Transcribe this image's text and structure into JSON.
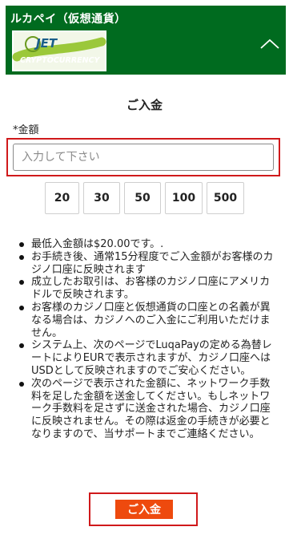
{
  "header": {
    "title": "ルカペイ（仮想通貨）",
    "logo_top_text": "JET",
    "logo_bottom_text": "CRYPTOCURRENCY",
    "collapse_icon": "chevron-up-icon",
    "bg_color": "#006b1f"
  },
  "form": {
    "title": "ご入金",
    "amount_label": "*金額",
    "amount_placeholder": "入力して下さい",
    "amount_value": "",
    "quick_amounts": [
      "20",
      "30",
      "50",
      "100",
      "500"
    ]
  },
  "notes": [
    "最低入金額は$20.00です。.",
    "お手続き後、通常15分程度でご入金額がお客様のカジノ口座に反映されます",
    "成立したお取引は、お客様のカジノ口座にアメリカドルで反映されます。",
    "お客様のカジノ口座と仮想通貨の口座との名義が異なる場合は、カジノへのご入金にご利用いただけません。",
    "システム上、次のページでLuqaPayの定める為替レートによりEURで表示されますが、カジノ口座へはUSDとして反映されますのでご安心ください。",
    "次のページで表示された金額に、ネットワーク手数料を足した金額を送金してください。もしネットワーク手数料を足さずに送金された場合、カジノ口座に反映されません。その際は返金の手続きが必要となりますので、当サポートまでご連絡ください。"
  ],
  "submit": {
    "label": "ご入金",
    "color": "#ee4a0e"
  },
  "highlight_color": "#d0191b"
}
